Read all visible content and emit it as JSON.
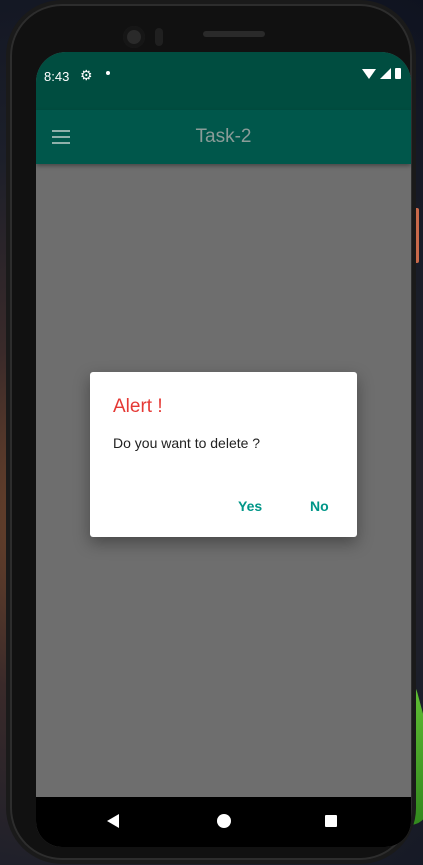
{
  "status_bar": {
    "time": "8:43",
    "icons": [
      "settings-icon",
      "notification-dot",
      "wifi-icon",
      "signal-icon",
      "battery-icon"
    ]
  },
  "app_bar": {
    "title": "Task-2",
    "menu_icon": "hamburger-menu-icon",
    "color": "#00574b"
  },
  "dialog": {
    "title": "Alert !",
    "message": "Do you want to delete ?",
    "buttons": {
      "yes": "Yes",
      "no": "No"
    },
    "title_color": "#e53935",
    "button_color": "#009688"
  },
  "nav_bar": {
    "icons": [
      "back-icon",
      "home-icon",
      "recents-icon"
    ]
  }
}
